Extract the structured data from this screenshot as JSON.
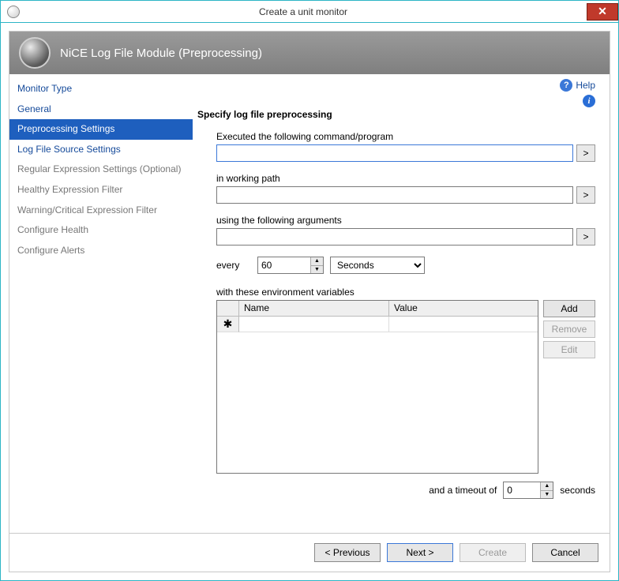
{
  "titlebar": {
    "title": "Create a unit monitor",
    "close_label": "✕"
  },
  "header": {
    "title": "NiCE Log File Module (Preprocessing)"
  },
  "sidebar": {
    "items": [
      {
        "label": "Monitor Type",
        "state": "normal"
      },
      {
        "label": "General",
        "state": "normal"
      },
      {
        "label": "Preprocessing Settings",
        "state": "active"
      },
      {
        "label": "Log File Source Settings",
        "state": "normal"
      },
      {
        "label": "Regular Expression Settings (Optional)",
        "state": "disabled"
      },
      {
        "label": "Healthy Expression Filter",
        "state": "disabled"
      },
      {
        "label": "Warning/Critical Expression Filter",
        "state": "disabled"
      },
      {
        "label": "Configure Health",
        "state": "disabled"
      },
      {
        "label": "Configure Alerts",
        "state": "disabled"
      }
    ]
  },
  "help_link": "Help",
  "content": {
    "section_title": "Specify log file preprocessing",
    "command_label": "Executed the following command/program",
    "command_value": "",
    "path_label": "in working path",
    "path_value": "",
    "args_label": "using the following arguments",
    "args_value": "",
    "browse_glyph": ">",
    "interval_label": "every",
    "interval_value": "60",
    "interval_unit_options": [
      "Seconds"
    ],
    "interval_unit_selected": "Seconds",
    "env_label": "with these environment variables",
    "grid": {
      "columns": {
        "name": "Name",
        "value": "Value"
      },
      "rows": []
    },
    "env_buttons": {
      "add": "Add",
      "remove": "Remove",
      "edit": "Edit"
    },
    "timeout_prefix": "and a timeout of",
    "timeout_value": "0",
    "timeout_suffix": "seconds"
  },
  "footer": {
    "previous": "< Previous",
    "next": "Next >",
    "create": "Create",
    "cancel": "Cancel"
  }
}
